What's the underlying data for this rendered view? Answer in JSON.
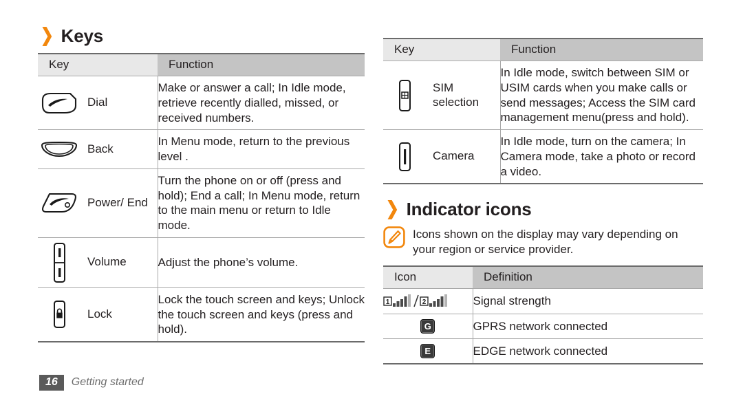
{
  "left": {
    "heading": "Keys",
    "table": {
      "columns": [
        "Key",
        "Function"
      ],
      "rows": [
        {
          "icon": "dial-key-icon",
          "key": "Dial",
          "function": "Make or answer a call; In Idle mode, retrieve recently dialled, missed, or received numbers."
        },
        {
          "icon": "back-key-icon",
          "key": "Back",
          "function": "In Menu mode, return to the previous level ."
        },
        {
          "icon": "power-end-key-icon",
          "key": "Power/ End",
          "function": "Turn the phone on or off (press and hold); End a call; In Menu mode, return to the main menu or return to Idle mode."
        },
        {
          "icon": "volume-key-icon",
          "key": "Volume",
          "function": "Adjust the phone’s volume."
        },
        {
          "icon": "lock-key-icon",
          "key": "Lock",
          "function": "Lock the touch screen and keys; Unlock the touch screen and keys (press and hold)."
        }
      ]
    }
  },
  "right": {
    "table": {
      "columns": [
        "Key",
        "Function"
      ],
      "rows": [
        {
          "icon": "sim-selection-key-icon",
          "key": "SIM selection",
          "function": "In Idle mode, switch between SIM or USIM cards when you make calls or send messages; Access the SIM card management menu(press and hold)."
        },
        {
          "icon": "camera-key-icon",
          "key": "Camera",
          "function": "In Idle mode, turn on the camera; In Camera mode, take a photo or record a video."
        }
      ]
    },
    "indicator_section": {
      "heading": "Indicator icons",
      "note": "Icons shown on the display may vary depending on your region or service provider.",
      "table": {
        "columns": [
          "Icon",
          "Definition"
        ],
        "rows": [
          {
            "icon": "signal-strength-icon",
            "definition": "Signal strength"
          },
          {
            "icon": "gprs-icon",
            "glyph": "G",
            "definition": "GPRS network connected"
          },
          {
            "icon": "edge-icon",
            "glyph": "E",
            "definition": "EDGE network connected"
          }
        ]
      }
    }
  },
  "footer": {
    "page_number": "16",
    "label": "Getting started"
  },
  "colors": {
    "accent": "#f2870d",
    "header_key_bg": "#e8e8e8",
    "header_fn_bg": "#c4c4c4",
    "rule": "#6b6b6b",
    "text": "#231f20"
  }
}
